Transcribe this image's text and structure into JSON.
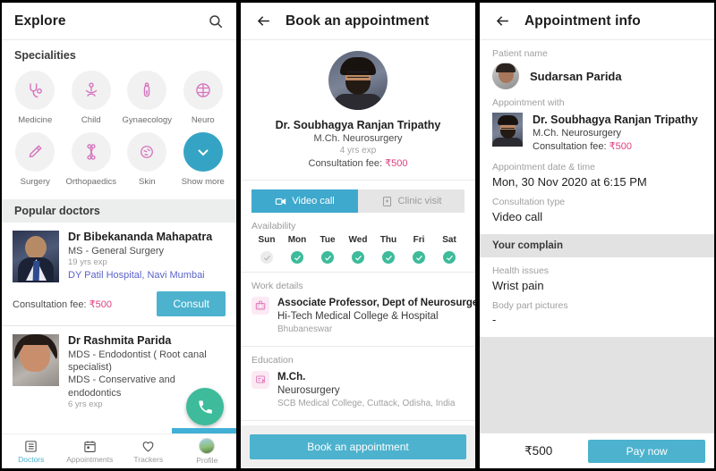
{
  "panel1": {
    "appbar": {
      "title": "Explore",
      "search_icon": "search-icon"
    },
    "specialities_heading": "Specialities",
    "specialities": [
      {
        "label": "Medicine",
        "icon": "stethoscope-icon"
      },
      {
        "label": "Child",
        "icon": "child-icon"
      },
      {
        "label": "Gynaecology",
        "icon": "gynaecology-icon"
      },
      {
        "label": "Neuro",
        "icon": "brain-icon"
      },
      {
        "label": "Surgery",
        "icon": "scalpel-icon"
      },
      {
        "label": "Orthopaedics",
        "icon": "bone-icon"
      },
      {
        "label": "Skin",
        "icon": "skin-icon"
      },
      {
        "label": "Show more",
        "icon": "chevron-down-icon"
      }
    ],
    "popular_heading": "Popular doctors",
    "doctors": [
      {
        "name": "Dr Bibekananda Mahapatra",
        "qualification": "MS - General Surgery",
        "experience": "19 yrs exp",
        "hospital": "DY Patil Hospital, Navi Mumbai",
        "fee_label": "Consultation fee: ",
        "fee_amount": "₹500",
        "cta": "Consult"
      },
      {
        "name": "Dr Rashmita Parida",
        "qualification": "MDS - Endodontist ( Root canal specialist)",
        "qualification2": "MDS - Conservative and endodontics",
        "experience": "6 yrs exp"
      }
    ],
    "fab_icon": "phone-call-icon",
    "tabs": [
      {
        "label": "Doctors",
        "icon": "list-icon",
        "active": true
      },
      {
        "label": "Appointments",
        "icon": "calendar-icon",
        "active": false
      },
      {
        "label": "Trackers",
        "icon": "heart-icon",
        "active": false
      },
      {
        "label": "Profile",
        "icon": "avatar-icon",
        "active": false
      }
    ]
  },
  "panel2": {
    "appbar": {
      "title": "Book an appointment",
      "back_icon": "back-arrow-icon"
    },
    "doctor": {
      "name": "Dr. Soubhagya Ranjan Tripathy",
      "qualification": "M.Ch. Neurosurgery",
      "experience": "4 yrs exp",
      "fee_label": "Consultation fee: ",
      "fee_amount": "₹500"
    },
    "segments": [
      {
        "label": "Video call",
        "icon": "video-camera-icon",
        "selected": true
      },
      {
        "label": "Clinic visit",
        "icon": "clinic-building-icon",
        "selected": false
      }
    ],
    "availability_label": "Availability",
    "availability": [
      {
        "day": "Sun",
        "available": false
      },
      {
        "day": "Mon",
        "available": true
      },
      {
        "day": "Tue",
        "available": true
      },
      {
        "day": "Wed",
        "available": true
      },
      {
        "day": "Thu",
        "available": true
      },
      {
        "day": "Fri",
        "available": true
      },
      {
        "day": "Sat",
        "available": true
      }
    ],
    "work": {
      "section_label": "Work details",
      "icon": "medical-bag-icon",
      "title": "Associate Professor, Dept of Neurosurgery",
      "subtitle": "Hi-Tech Medical College & Hospital",
      "location": "Bhubaneswar"
    },
    "education": {
      "section_label": "Education",
      "icon": "certificate-icon",
      "title": "M.Ch.",
      "subtitle": "Neurosurgery",
      "location": "SCB Medical College, Cuttack, Odisha, India"
    },
    "cta": "Book an appointment"
  },
  "panel3": {
    "appbar": {
      "title": "Appointment info",
      "back_icon": "back-arrow-icon"
    },
    "patient_label": "Patient name",
    "patient_name": "Sudarsan Parida",
    "appointment_with_label": "Appointment with",
    "doctor": {
      "name": "Dr. Soubhagya Ranjan Tripathy",
      "qualification": "M.Ch. Neurosurgery",
      "fee_label": "Consultation fee: ",
      "fee_amount": "₹500"
    },
    "datetime_label": "Appointment date & time",
    "datetime_value": "Mon, 30 Nov 2020 at 6:15 PM",
    "type_label": "Consultation type",
    "type_value": "Video call",
    "complain_band": "Your complain",
    "health_label": "Health issues",
    "health_value": "Wrist pain",
    "pictures_label": "Body part pictures",
    "pictures_value": "-",
    "total_amount": "₹500",
    "cta": "Pay now"
  },
  "colors": {
    "accent_blue": "#4cb2ce",
    "segment_blue": "#3fa9cd",
    "green": "#3dbb9b",
    "pink": "#e0407f",
    "link_blue": "#5b63c9",
    "icon_pink": "#e07fbd"
  }
}
